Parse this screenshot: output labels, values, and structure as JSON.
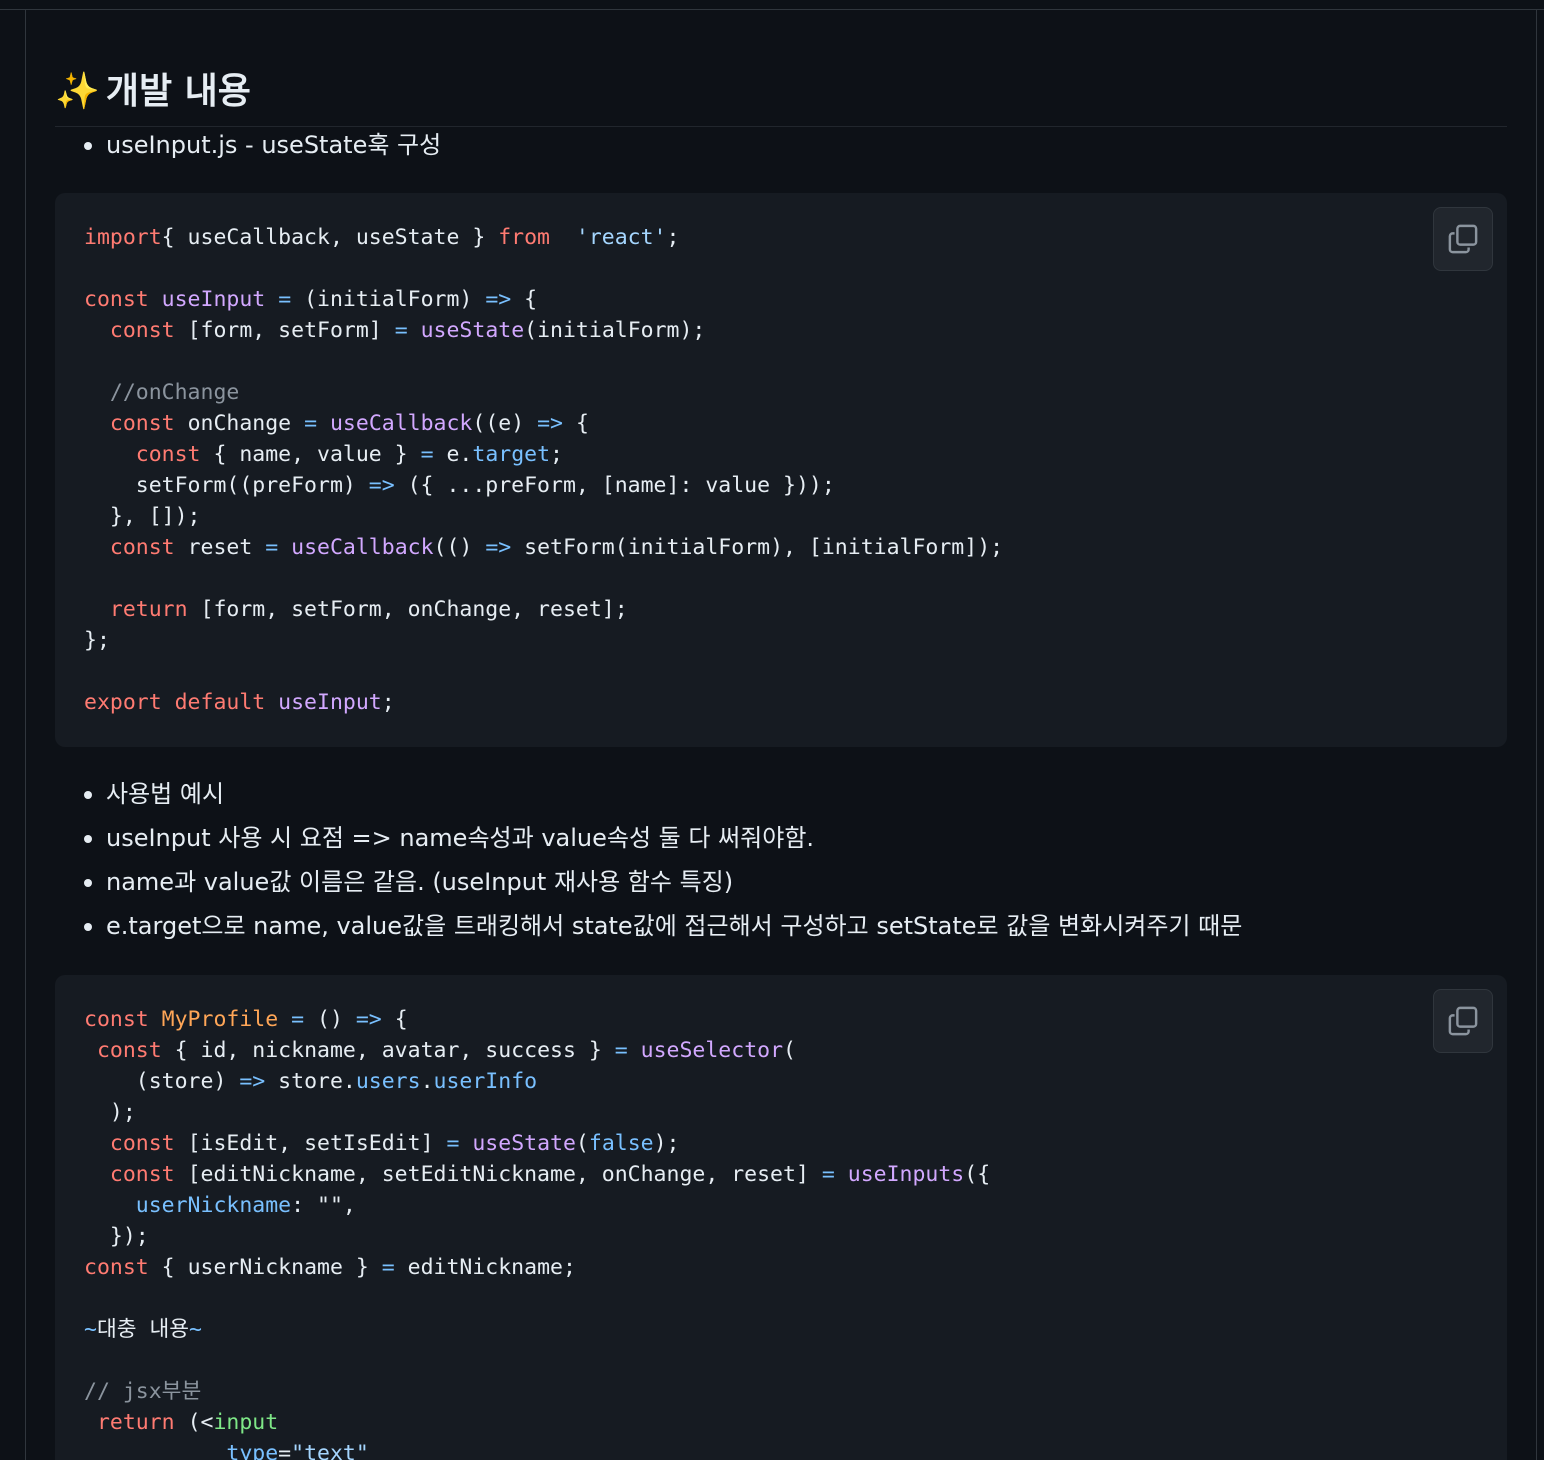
{
  "heading": {
    "emoji": "✨",
    "title": "개발 내용"
  },
  "bullets_top": [
    "useInput.js - useState훅 구성"
  ],
  "code_block_1": {
    "lines": [
      [
        [
          "kw",
          "import"
        ],
        [
          "",
          "{ useCallback, useState } "
        ],
        [
          "kw",
          "from"
        ],
        [
          "",
          "  "
        ],
        [
          "str",
          "'react'"
        ],
        [
          "",
          ";"
        ]
      ],
      [],
      [
        [
          "kw",
          "const "
        ],
        [
          "fn",
          "useInput"
        ],
        [
          "",
          " "
        ],
        [
          "prop",
          "="
        ],
        [
          "",
          " (initialForm) "
        ],
        [
          "prop",
          "=>"
        ],
        [
          "",
          " {"
        ]
      ],
      [
        [
          "",
          "  "
        ],
        [
          "kw",
          "const"
        ],
        [
          "",
          " [form, setForm] "
        ],
        [
          "prop",
          "="
        ],
        [
          "",
          " "
        ],
        [
          "fn",
          "useState"
        ],
        [
          "",
          "(initialForm);"
        ]
      ],
      [],
      [
        [
          "cmt",
          "  //onChange"
        ]
      ],
      [
        [
          "",
          "  "
        ],
        [
          "kw",
          "const"
        ],
        [
          "",
          " onChange "
        ],
        [
          "prop",
          "="
        ],
        [
          "",
          " "
        ],
        [
          "fn",
          "useCallback"
        ],
        [
          "",
          "((e) "
        ],
        [
          "prop",
          "=>"
        ],
        [
          "",
          " {"
        ]
      ],
      [
        [
          "",
          "    "
        ],
        [
          "kw",
          "const"
        ],
        [
          "",
          " { name, value } "
        ],
        [
          "prop",
          "="
        ],
        [
          "",
          " e."
        ],
        [
          "prop",
          "target"
        ],
        [
          "",
          ";"
        ]
      ],
      [
        [
          "",
          "    setForm((preForm) "
        ],
        [
          "prop",
          "=>"
        ],
        [
          "",
          " ({ ...preForm, [name]: value }));"
        ]
      ],
      [
        [
          "",
          "  }, []);"
        ]
      ],
      [
        [
          "",
          "  "
        ],
        [
          "kw",
          "const"
        ],
        [
          "",
          " reset "
        ],
        [
          "prop",
          "="
        ],
        [
          "",
          " "
        ],
        [
          "fn",
          "useCallback"
        ],
        [
          "",
          "(() "
        ],
        [
          "prop",
          "=>"
        ],
        [
          "",
          " setForm(initialForm), [initialForm]);"
        ]
      ],
      [],
      [
        [
          "",
          "  "
        ],
        [
          "kw",
          "return"
        ],
        [
          "",
          " [form, setForm, onChange, reset];"
        ]
      ],
      [
        [
          "",
          "};"
        ]
      ],
      [],
      [
        [
          "kw",
          "export default "
        ],
        [
          "fn",
          "useInput"
        ],
        [
          "",
          ";"
        ]
      ]
    ]
  },
  "bullets_mid": [
    "사용법 예시",
    "useInput 사용 시 요점 => name속성과 value속성 둘 다 써줘야함.",
    "name과 value값 이름은 같음. (useInput 재사용 함수 특징)",
    "e.target으로 name, value값을 트래킹해서 state값에 접근해서 구성하고 setState로 값을 변화시켜주기 때문"
  ],
  "code_block_2": {
    "lines": [
      [
        [
          "kw",
          "const "
        ],
        [
          "cls",
          "MyProfile"
        ],
        [
          "",
          " "
        ],
        [
          "prop",
          "="
        ],
        [
          "",
          " () "
        ],
        [
          "prop",
          "=>"
        ],
        [
          "",
          " {"
        ]
      ],
      [
        [
          "",
          " "
        ],
        [
          "kw",
          "const"
        ],
        [
          "",
          " { id, nickname, avatar, success } "
        ],
        [
          "prop",
          "="
        ],
        [
          "",
          " "
        ],
        [
          "fn",
          "useSelector"
        ],
        [
          "",
          "("
        ]
      ],
      [
        [
          "",
          "    (store) "
        ],
        [
          "prop",
          "=>"
        ],
        [
          "",
          " store."
        ],
        [
          "prop",
          "users"
        ],
        [
          "",
          "."
        ],
        [
          "prop",
          "userInfo"
        ]
      ],
      [
        [
          "",
          "  );"
        ]
      ],
      [
        [
          "",
          "  "
        ],
        [
          "kw",
          "const"
        ],
        [
          "",
          " [isEdit, setIsEdit] "
        ],
        [
          "prop",
          "="
        ],
        [
          "",
          " "
        ],
        [
          "fn",
          "useState"
        ],
        [
          "",
          "("
        ],
        [
          "prop",
          "false"
        ],
        [
          "",
          ");"
        ]
      ],
      [
        [
          "",
          "  "
        ],
        [
          "kw",
          "const"
        ],
        [
          "",
          " [editNickname, setEditNickname, onChange, reset] "
        ],
        [
          "prop",
          "="
        ],
        [
          "",
          " "
        ],
        [
          "fn",
          "useInputs"
        ],
        [
          "",
          "({"
        ]
      ],
      [
        [
          "",
          "    "
        ],
        [
          "prop",
          "userNickname"
        ],
        [
          "",
          ": \"\","
        ]
      ],
      [
        [
          "",
          "  });"
        ]
      ],
      [
        [
          "kw",
          "const"
        ],
        [
          "",
          " { userNickname } "
        ],
        [
          "prop",
          "="
        ],
        [
          "",
          " editNickname;"
        ]
      ],
      [],
      [
        [
          "prop",
          "~"
        ],
        [
          "",
          "대충 내용"
        ],
        [
          "prop",
          "~"
        ]
      ],
      [],
      [
        [
          "cmt",
          "// jsx부분"
        ]
      ],
      [
        [
          "",
          " "
        ],
        [
          "kw",
          "return"
        ],
        [
          "",
          " (<"
        ],
        [
          "tag",
          "input"
        ]
      ],
      [
        [
          "",
          "           "
        ],
        [
          "prop",
          "type"
        ],
        [
          "",
          "="
        ],
        [
          "str",
          "\"text\""
        ]
      ]
    ]
  },
  "copy_tooltip": "Copy"
}
